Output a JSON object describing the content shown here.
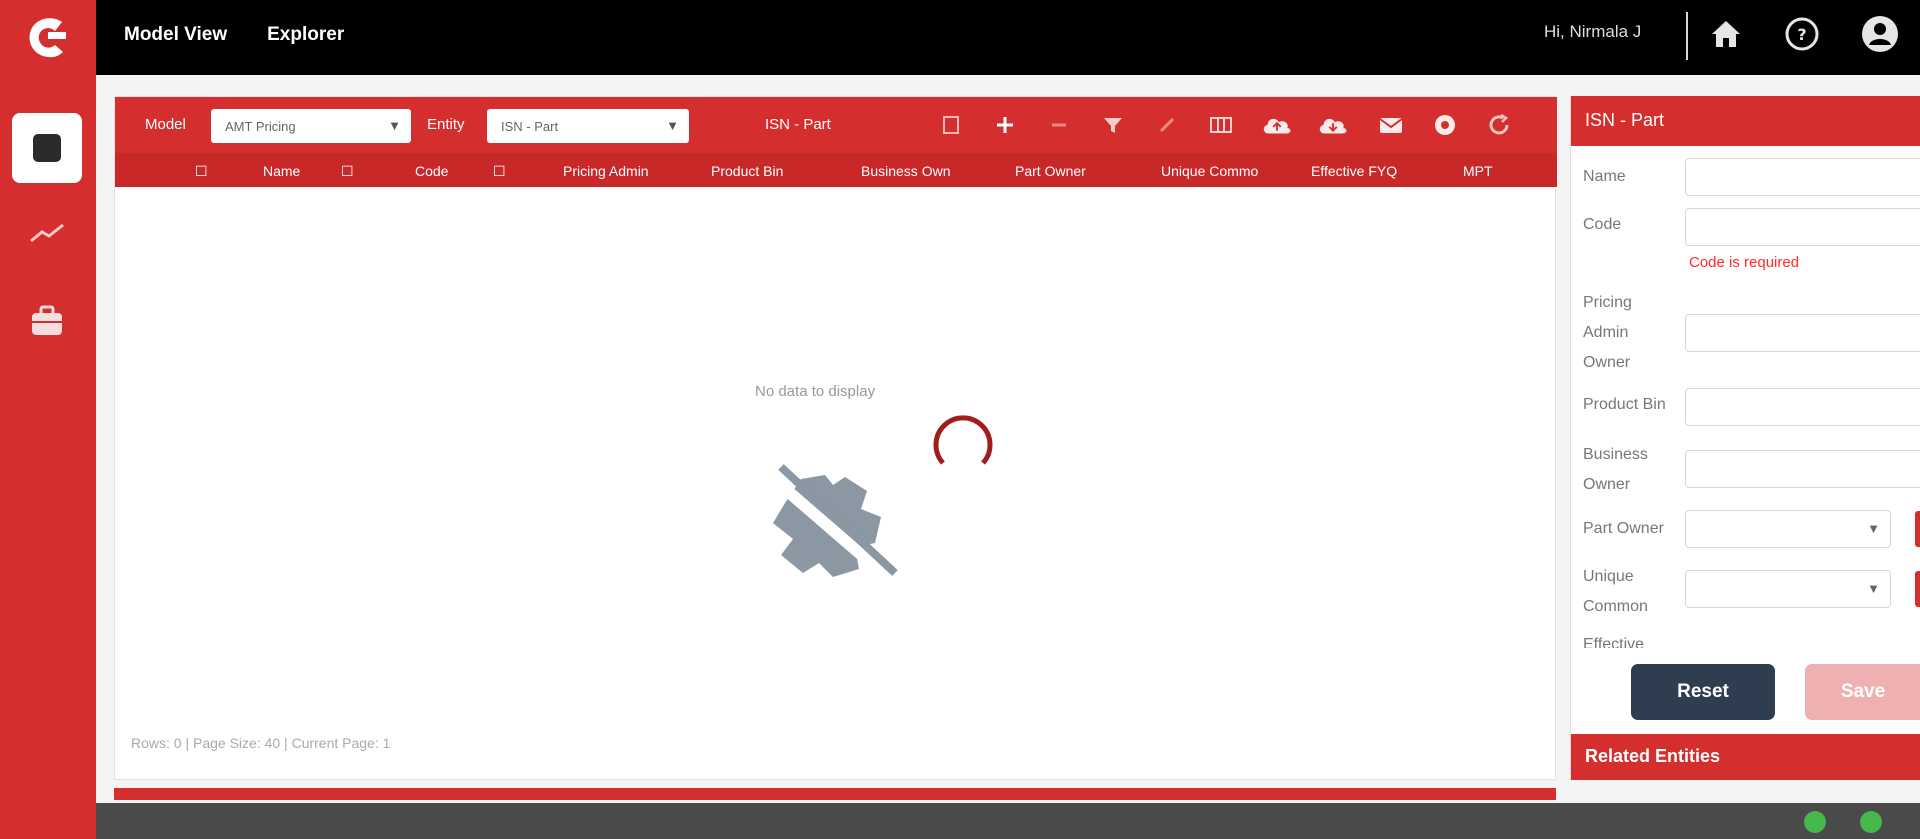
{
  "nav": {
    "items": [
      "Model View",
      "Explorer"
    ]
  },
  "user": {
    "greeting": "Hi, Nirmala J"
  },
  "toolbar": {
    "model_label": "Model",
    "model_value": "AMT Pricing",
    "entity_label": "Entity",
    "entity_value": "ISN - Part",
    "title": "ISN - Part"
  },
  "grid": {
    "columns": [
      "Name",
      "Code",
      "Pricing Admin",
      "Product Bin",
      "Business Own",
      "Part Owner",
      "Unique Commo",
      "Effective FYQ",
      "MPT"
    ],
    "empty_message": "No data to display",
    "footer": "Rows: 0 | Page Size: 40 | Current Page: 1"
  },
  "form": {
    "title": "ISN - Part",
    "labels": {
      "name": "Name",
      "code": "Code",
      "pricing_admin": "Pricing Admin Owner",
      "product_bin": "Product Bin",
      "business_owner": "Business Owner",
      "part_owner": "Part Owner",
      "unique_common": "Unique Common",
      "effective": "Effective"
    },
    "error": "Code is required",
    "reset_label": "Reset",
    "save_label": "Save",
    "related_label": "Related Entities"
  },
  "colors": {
    "brand_red": "#d42e2e",
    "dark_button": "#2e3d4f",
    "error_red": "#ff2a2a"
  }
}
